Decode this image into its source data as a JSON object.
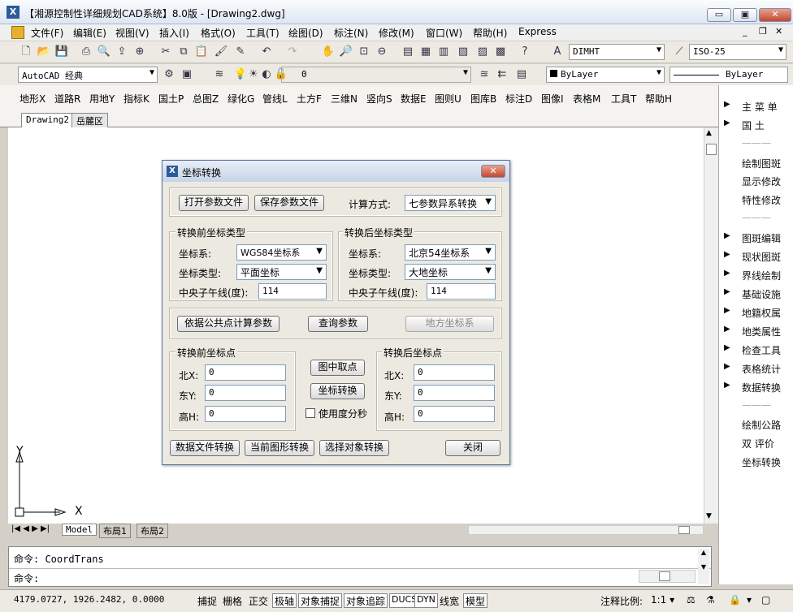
{
  "app": {
    "title": "【湘源控制性详细规划CAD系统】8.0版 - [Drawing2.dwg]",
    "icon_label": "X"
  },
  "window_controls": {
    "minimize": "▭",
    "restore": "▣",
    "close": "✕"
  },
  "mdi_controls": {
    "minimize": "_",
    "restore": "❐",
    "close": "✕"
  },
  "menu": [
    "文件(F)",
    "编辑(E)",
    "视图(V)",
    "插入(I)",
    "格式(O)",
    "工具(T)",
    "绘图(D)",
    "标注(N)",
    "修改(M)",
    "窗口(W)",
    "帮助(H)",
    "Express"
  ],
  "toolbar": {
    "dimstyle": "DIMHT",
    "textstyle": "ISO-25",
    "workspace": "AutoCAD 经典",
    "layer": "0",
    "color": "ByLayer",
    "linetype": "ByLayer"
  },
  "cad_menu": [
    "地形X",
    "道路R",
    "用地Y",
    "指标K",
    "国土P",
    "总图Z",
    "绿化G",
    "管线L",
    "土方F",
    "三维N",
    "竖向S",
    "数据E",
    "图则U",
    "图库B",
    "标注D",
    "图像I",
    "表格M",
    "工具T",
    "帮助H"
  ],
  "doc_tabs": [
    "Drawing2",
    "岳麓区"
  ],
  "right_panel": {
    "items": [
      {
        "label": "主 菜 单",
        "arrow": true
      },
      {
        "label": "国    土",
        "arrow": true
      },
      {
        "label": "———",
        "arrow": false
      },
      {
        "label": "绘制图斑",
        "arrow": false
      },
      {
        "label": "显示修改",
        "arrow": false
      },
      {
        "label": "特性修改",
        "arrow": false
      },
      {
        "label": "———",
        "arrow": false
      },
      {
        "label": "图斑编辑",
        "arrow": true
      },
      {
        "label": "现状图斑",
        "arrow": true
      },
      {
        "label": "界线绘制",
        "arrow": true
      },
      {
        "label": "基础设施",
        "arrow": true
      },
      {
        "label": "地籍权属",
        "arrow": true
      },
      {
        "label": "地类属性",
        "arrow": true
      },
      {
        "label": "检查工具",
        "arrow": true
      },
      {
        "label": "表格统计",
        "arrow": true
      },
      {
        "label": "数据转换",
        "arrow": true
      },
      {
        "label": "———",
        "arrow": false
      },
      {
        "label": "绘制公路",
        "arrow": false
      },
      {
        "label": "双   评价",
        "arrow": false
      },
      {
        "label": "坐标转换",
        "arrow": false
      }
    ]
  },
  "axes": {
    "y": "Y",
    "x": "X"
  },
  "layout_tabs": [
    "Model",
    "布局1",
    "布局2"
  ],
  "command": {
    "history": "命令: CoordTrans",
    "prompt": "命令:"
  },
  "status": {
    "coords": "4179.0727, 1926.2482, 0.0000",
    "toggles": [
      "捕捉",
      "栅格",
      "正交",
      "极轴",
      "对象捕捉",
      "对象追踪",
      "DUCS",
      "DYN",
      "线宽",
      "模型"
    ],
    "annotation_scale_label": "注释比例:",
    "annotation_scale": "1:1"
  },
  "dialog": {
    "title": "坐标转换",
    "open_param_file": "打开参数文件",
    "save_param_file": "保存参数文件",
    "calc_method_label": "计算方式:",
    "calc_method": "七参数异系转换",
    "before_type_group": "转换前坐标类型",
    "after_type_group": "转换后坐标类型",
    "coord_sys_label": "坐标系:",
    "coord_type_label": "坐标类型:",
    "central_meridian_label": "中央子午线(度):",
    "before": {
      "coord_sys": "WGS84坐标系",
      "coord_type": "平面坐标",
      "meridian": "114"
    },
    "after": {
      "coord_sys": "北京54坐标系",
      "coord_type": "大地坐标",
      "meridian": "114"
    },
    "calc_by_common_points": "依据公共点计算参数",
    "query_params": "查询参数",
    "local_coord_sys": "地方坐标系",
    "before_point_group": "转换前坐标点",
    "after_point_group": "转换后坐标点",
    "north_label": "北X:",
    "east_label": "东Y:",
    "height_label": "高H:",
    "before_point": {
      "x": "0",
      "y": "0",
      "h": "0"
    },
    "after_point": {
      "x": "0",
      "y": "0",
      "h": "0"
    },
    "pick_in_drawing": "图中取点",
    "convert": "坐标转换",
    "use_dms": "使用度分秒",
    "data_file_convert": "数据文件转换",
    "current_drawing_convert": "当前图形转换",
    "select_object_convert": "选择对象转换",
    "close": "关闭"
  }
}
